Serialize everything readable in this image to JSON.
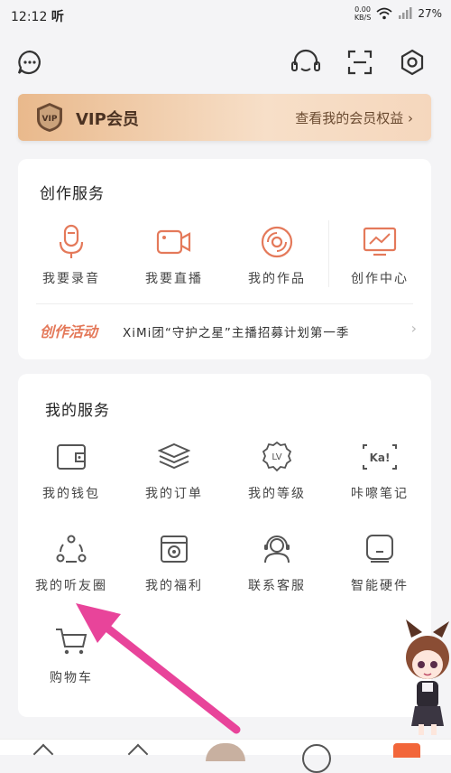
{
  "status_bar": {
    "time": "12:12",
    "carrier": "听",
    "speed_value": "0.00",
    "speed_unit": "KB/S",
    "battery": "27%"
  },
  "header": {
    "icons": [
      "message-icon",
      "headset-icon",
      "scan-icon",
      "settings-icon"
    ]
  },
  "vip": {
    "title": "VIP会员",
    "link": "查看我的会员权益 ›",
    "badge_text": "VIP"
  },
  "creation": {
    "title": "创作服务",
    "items": [
      {
        "label": "我要录音",
        "icon": "microphone-icon"
      },
      {
        "label": "我要直播",
        "icon": "video-camera-icon"
      },
      {
        "label": "我的作品",
        "icon": "disc-icon"
      },
      {
        "label": "创作中心",
        "icon": "chart-screen-icon"
      }
    ],
    "activity": {
      "tag": "创作活动",
      "text": "XiMi团“守护之星”主播招募计划第一季",
      "arrow": "›"
    }
  },
  "services": {
    "title": "我的服务",
    "items": [
      {
        "label": "我的钱包",
        "icon": "wallet-icon"
      },
      {
        "label": "我的订单",
        "icon": "layers-icon"
      },
      {
        "label": "我的等级",
        "icon": "level-badge-icon",
        "icon_text": "LV"
      },
      {
        "label": "咔嚓笔记",
        "icon": "ka-note-icon",
        "icon_text": "Ka!"
      },
      {
        "label": "我的听友圈",
        "icon": "friends-circle-icon"
      },
      {
        "label": "我的福利",
        "icon": "gift-box-icon"
      },
      {
        "label": "联系客服",
        "icon": "customer-service-icon"
      },
      {
        "label": "智能硬件",
        "icon": "smart-device-icon"
      },
      {
        "label": "购物车",
        "icon": "cart-icon"
      }
    ]
  },
  "colors": {
    "accent": "#e4795a",
    "icon": "#555555",
    "vip_text": "#4b3222",
    "arrow": "#e8449a"
  }
}
